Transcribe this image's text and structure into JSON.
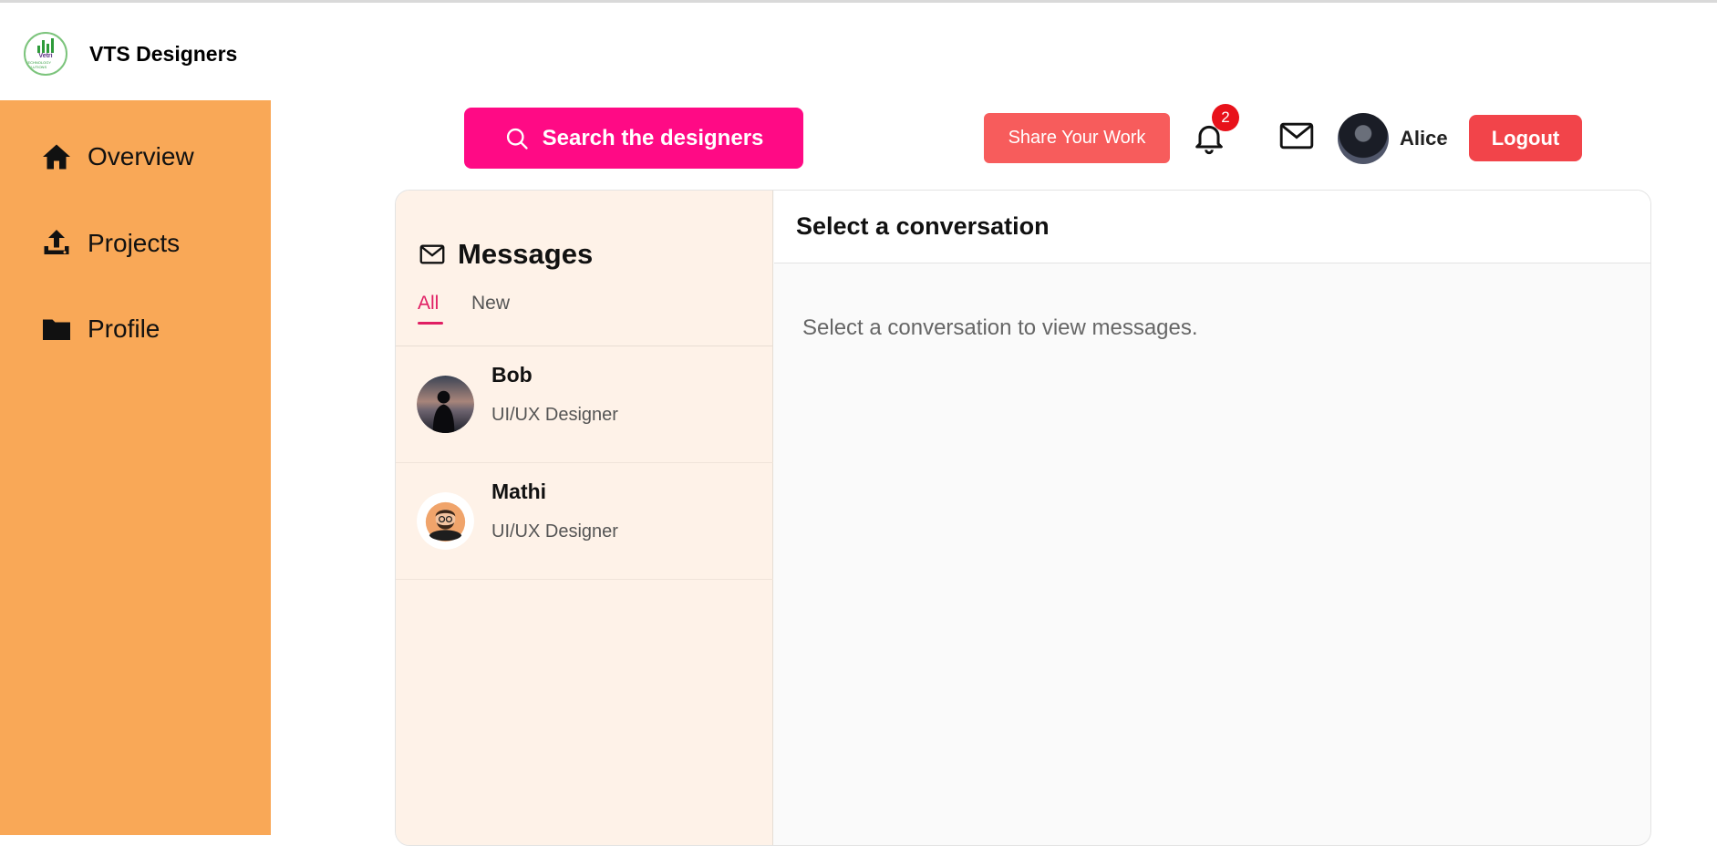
{
  "brand": {
    "name": "VTS Designers",
    "logo_text": "Vetri",
    "logo_sub": "TECHNOLOGY SOLUTIONS"
  },
  "sidebar": {
    "items": [
      {
        "label": "Overview",
        "icon": "home-icon"
      },
      {
        "label": "Projects",
        "icon": "upload-icon"
      },
      {
        "label": "Profile",
        "icon": "folder-icon"
      }
    ]
  },
  "header": {
    "search_label": "Search the designers",
    "share_label": "Share Your Work",
    "notification_count": "2",
    "user_name": "Alice",
    "logout_label": "Logout"
  },
  "messages": {
    "title": "Messages",
    "tabs": [
      "All",
      "New"
    ],
    "active_tab": "All",
    "conversations": [
      {
        "name": "Bob",
        "role": "UI/UX Designer"
      },
      {
        "name": "Mathi",
        "role": "UI/UX Designer"
      }
    ]
  },
  "conversation_view": {
    "title": "Select a conversation",
    "empty_text": "Select a conversation to view messages."
  },
  "colors": {
    "sidebar": "#f9a857",
    "search_button": "#ff0a85",
    "share_button": "#f75c5c",
    "logout_button": "#f2444a",
    "accent": "#e01e63",
    "badge": "#e8111a"
  }
}
